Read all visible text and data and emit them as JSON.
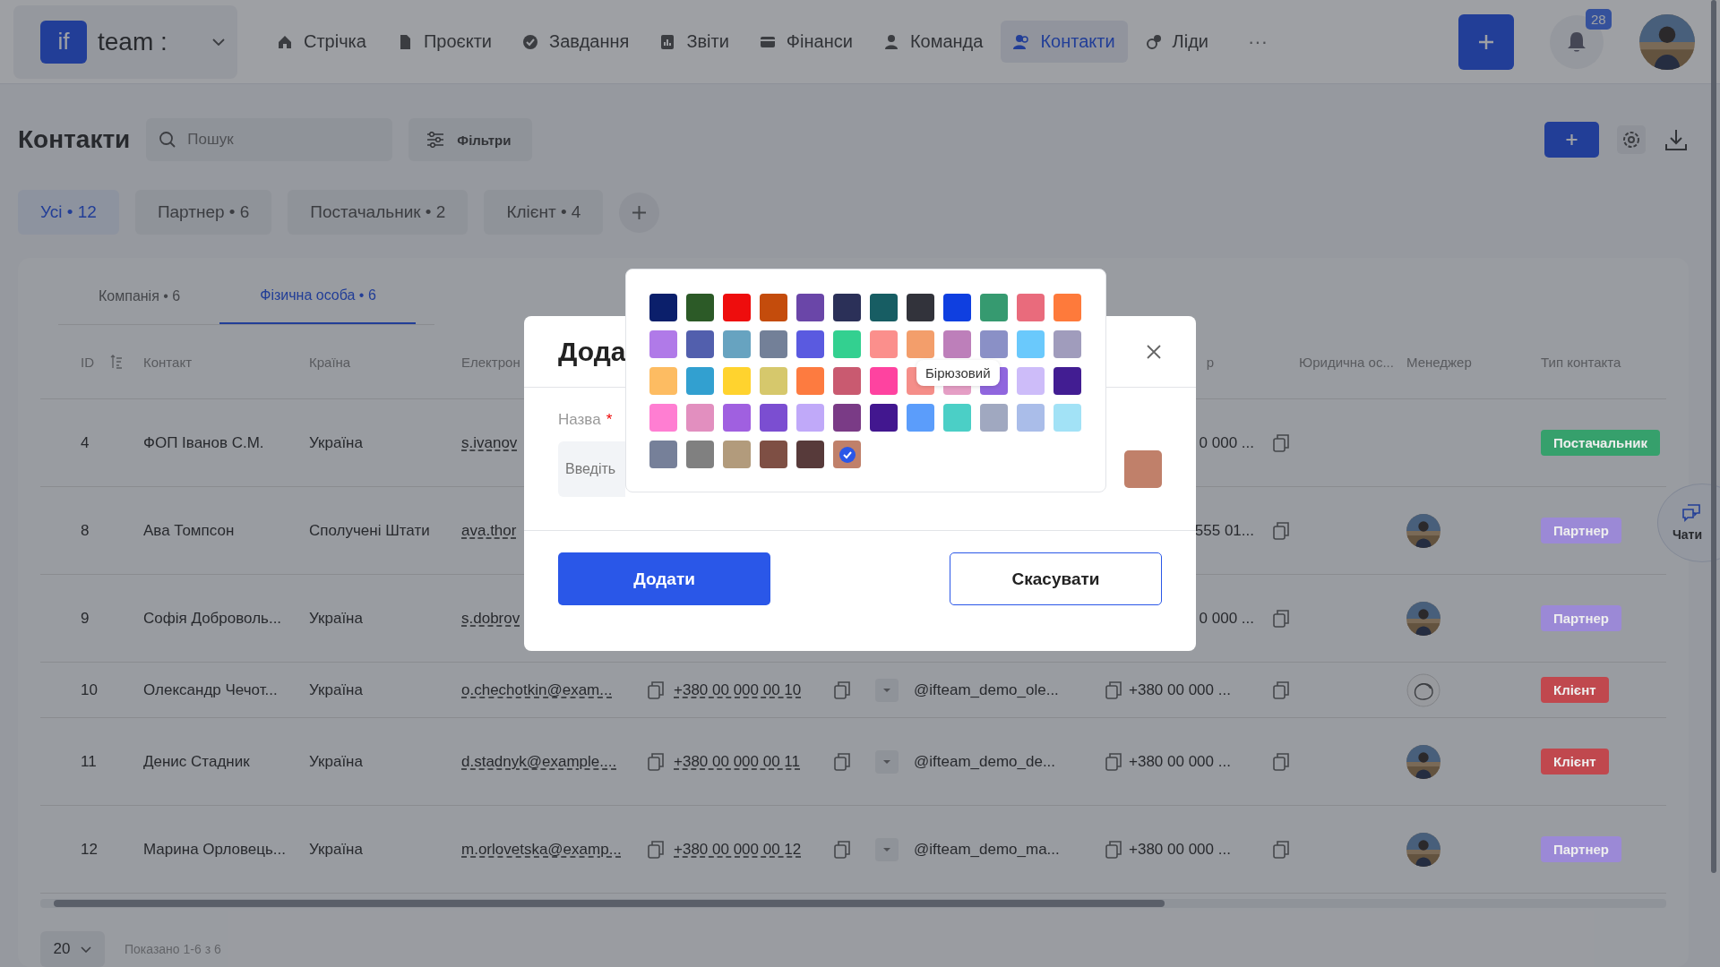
{
  "topbar": {
    "logo": "if",
    "workspace": "team :",
    "nav": [
      {
        "label": "Стрічка",
        "selected": false
      },
      {
        "label": "Проєкти",
        "selected": false
      },
      {
        "label": "Завдання",
        "selected": false
      },
      {
        "label": "Звіти",
        "selected": false
      },
      {
        "label": "Фінанси",
        "selected": false
      },
      {
        "label": "Команда",
        "selected": false
      },
      {
        "label": "Контакти",
        "selected": true
      },
      {
        "label": "Ліди",
        "selected": false
      }
    ],
    "more": "···",
    "notifications": "28"
  },
  "page": {
    "title": "Контакти",
    "search": {
      "placeholder": "Пошук"
    },
    "filters": "Фільтри"
  },
  "chips": [
    {
      "label": "Усі • 12",
      "selected": true
    },
    {
      "label": "Партнер • 6",
      "selected": false
    },
    {
      "label": "Постачальник • 2",
      "selected": false
    },
    {
      "label": "Клієнт • 4",
      "selected": false
    }
  ],
  "subtabs": [
    {
      "label": "Компанія • 6",
      "selected": false
    },
    {
      "label": "Фізична особа • 6",
      "selected": true
    }
  ],
  "table": {
    "columns": [
      {
        "label": "ID"
      },
      {
        "label": "Контакт"
      },
      {
        "label": "Країна"
      },
      {
        "label": "Електрон"
      },
      {
        "label": "р"
      },
      {
        "label": "Юридична ос..."
      },
      {
        "label": "Менеджер"
      },
      {
        "label": "Тип контакта"
      }
    ],
    "rows": [
      {
        "id": "4",
        "contact": "ФОП Іванов С.М.",
        "country": "Україна",
        "email": "s.ivanov",
        "phone2": "0 000 ...",
        "type": {
          "label": "Постачальник",
          "color": "#36a06c"
        }
      },
      {
        "id": "8",
        "contact": "Ава Томпсон",
        "country": "Сполучені Штати",
        "email": "ava.thor",
        "phone2": "555 01...",
        "type": {
          "label": "Партнер",
          "color": "#9b89d6"
        }
      },
      {
        "id": "9",
        "contact": "Софія Доброволь...",
        "country": "Україна",
        "email": "s.dobrov",
        "phone2": "0 000 ...",
        "type": {
          "label": "Партнер",
          "color": "#9b89d6"
        }
      },
      {
        "id": "10",
        "contact": "Олександр Чечот...",
        "country": "Україна",
        "email": "o.chechotkin@exam...",
        "phone": "+380 00 000 00 10",
        "telegram": "@ifteam_demo_ole...",
        "phone2": "+380 00 000 ...",
        "manager": {
          "kind": "illustration"
        },
        "type": {
          "label": "Клієнт",
          "color": "#c0484e"
        }
      },
      {
        "id": "11",
        "contact": "Денис Стадник",
        "country": "Україна",
        "email": "d.stadnyk@example....",
        "phone": "+380 00 000 00 11",
        "telegram": "@ifteam_demo_de...",
        "phone2": "+380 00 000 ...",
        "type": {
          "label": "Клієнт",
          "color": "#c0484e"
        }
      },
      {
        "id": "12",
        "contact": "Марина Орловець...",
        "country": "Україна",
        "email": "m.orlovetska@examp...",
        "phone": "+380 00 000 00 12",
        "telegram": "@ifteam_demo_ma...",
        "phone2": "+380 00 000 ...",
        "type": {
          "label": "Партнер",
          "color": "#9b89d6"
        }
      }
    ]
  },
  "pagination": {
    "page_size": "20",
    "summary": "Показано 1-6 з 6"
  },
  "chat": {
    "label": "Чати"
  },
  "dialog": {
    "title": "Дода",
    "field": {
      "label": "Назва",
      "required_mark": "*",
      "placeholder": "Введіть"
    },
    "primary": "Додати",
    "secondary": "Скасувати"
  },
  "palette": {
    "tooltip": "Бірюзовий",
    "swatches": [
      {
        "color": "#0b1f6b",
        "selected": false
      },
      {
        "color": "#2c5a27",
        "selected": false
      },
      {
        "color": "#ee0d0d",
        "selected": false
      },
      {
        "color": "#c44c0c",
        "selected": false
      },
      {
        "color": "#6a46a8",
        "selected": false
      },
      {
        "color": "#2b3058",
        "selected": false
      },
      {
        "color": "#175d63",
        "selected": false
      },
      {
        "color": "#32333b",
        "selected": false
      },
      {
        "color": "#0f3fe0",
        "selected": false
      },
      {
        "color": "#369a70",
        "selected": false
      },
      {
        "color": "#e96b7c",
        "selected": false
      },
      {
        "color": "#fe7a3b",
        "selected": false
      },
      {
        "color": "#b07ae8",
        "selected": false
      },
      {
        "color": "#525fad",
        "selected": false
      },
      {
        "color": "#67a3c0",
        "selected": false
      },
      {
        "color": "#738098",
        "selected": false
      },
      {
        "color": "#5a5ae0",
        "selected": false
      },
      {
        "color": "#33d090",
        "selected": false
      },
      {
        "color": "#fb8f8c",
        "selected": false
      },
      {
        "color": "#f39e6b",
        "selected": false
      },
      {
        "color": "#bd7fba",
        "selected": false
      },
      {
        "color": "#8a90c6",
        "selected": false
      },
      {
        "color": "#6ac9fc",
        "selected": false
      },
      {
        "color": "#a09cbc",
        "selected": false
      },
      {
        "color": "#fdbc62",
        "selected": false
      },
      {
        "color": "#32a0d0",
        "selected": false
      },
      {
        "color": "#ffd32e",
        "selected": false
      },
      {
        "color": "#d6c86c",
        "selected": false
      },
      {
        "color": "#fd7b40",
        "selected": false
      },
      {
        "color": "#c95a70",
        "selected": false
      },
      {
        "color": "#fe43a0",
        "selected": false
      },
      {
        "color": "#f58e89",
        "selected": false
      },
      {
        "color": "#e59ec5",
        "selected": false
      },
      {
        "color": "#9066de",
        "selected": false
      },
      {
        "color": "#cdbcf9",
        "selected": false
      },
      {
        "color": "#421d92",
        "selected": false
      },
      {
        "color": "#ff7ed2",
        "selected": false
      },
      {
        "color": "#e28fbf",
        "selected": false
      },
      {
        "color": "#a060e0",
        "selected": false
      },
      {
        "color": "#7b4ed1",
        "selected": false
      },
      {
        "color": "#c0a9f9",
        "selected": false
      },
      {
        "color": "#7a3b86",
        "selected": false
      },
      {
        "color": "#42178f",
        "selected": false
      },
      {
        "color": "#5b9dfb",
        "selected": false
      },
      {
        "color": "#4bcfc6",
        "selected": false
      },
      {
        "color": "#a0a8c0",
        "selected": false
      },
      {
        "color": "#aabde9",
        "selected": false
      },
      {
        "color": "#a2e2f6",
        "selected": false
      },
      {
        "color": "#768099",
        "selected": false
      },
      {
        "color": "#808080",
        "selected": false
      },
      {
        "color": "#b29b7c",
        "selected": false
      },
      {
        "color": "#7e4f44",
        "selected": false
      },
      {
        "color": "#573a3a",
        "selected": false
      },
      {
        "color": "#c0806a",
        "selected": true
      }
    ]
  }
}
